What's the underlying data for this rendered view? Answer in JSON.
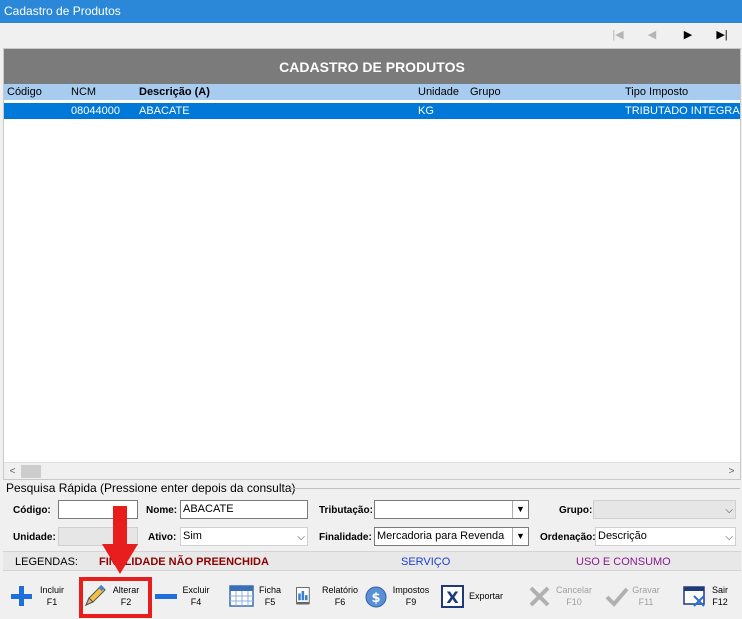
{
  "window": {
    "title": "Cadastro de Produtos"
  },
  "nav": {
    "first": "|◀",
    "prev": "◀",
    "next": "▶",
    "last": "▶|"
  },
  "grid": {
    "title": "CADASTRO DE PRODUTOS",
    "columns": [
      "Código",
      "NCM",
      "Descrição (A)",
      "Unidade",
      "Grupo",
      "Tipo Imposto"
    ],
    "rows": [
      {
        "codigo": "",
        "ncm": "08044000",
        "descricao": "ABACATE",
        "unidade": "KG",
        "grupo": "",
        "tipo_imposto": "TRIBUTADO INTEGRAL"
      }
    ]
  },
  "search": {
    "title": "Pesquisa Rápida (Pressione enter depois da consulta)",
    "codigo_label": "Código:",
    "codigo_value": "",
    "nome_label": "Nome:",
    "nome_value": "ABACATE",
    "tributacao_label": "Tributação:",
    "tributacao_value": "",
    "grupo_label": "Grupo:",
    "grupo_value": "",
    "unidade_label": "Unidade:",
    "unidade_value": "",
    "ativo_label": "Ativo:",
    "ativo_value": "Sim",
    "finalidade_label": "Finalidade:",
    "finalidade_value": "Mercadoria para Revenda",
    "ordenacao_label": "Ordenação:",
    "ordenacao_value": "Descrição"
  },
  "legend": {
    "label": "LEGENDAS:",
    "item1": "FINALIDADE NÃO PREENCHIDA",
    "item1_color": "#8b0000",
    "item2": "SERVIÇO",
    "item2_color": "#1a3fd0",
    "item3": "USO E CONSUMO",
    "item3_color": "#8b1a8b"
  },
  "toolbar": {
    "incluir": "Incluir",
    "incluir_key": "F1",
    "alterar": "Alterar",
    "alterar_key": "F2",
    "excluir": "Excluir",
    "excluir_key": "F4",
    "ficha": "Ficha",
    "ficha_key": "F5",
    "relatorio": "Relatório",
    "relatorio_key": "F6",
    "impostos": "Impostos",
    "impostos_key": "F9",
    "exportar": "Exportar",
    "cancelar": "Cancelar",
    "cancelar_key": "F10",
    "gravar": "Gravar",
    "gravar_key": "F11",
    "sair": "Sair",
    "sair_key": "F12"
  },
  "colors": {
    "titlebar": "#2b88d8",
    "selection": "#0078d7",
    "highlight": "#e81d1d"
  }
}
